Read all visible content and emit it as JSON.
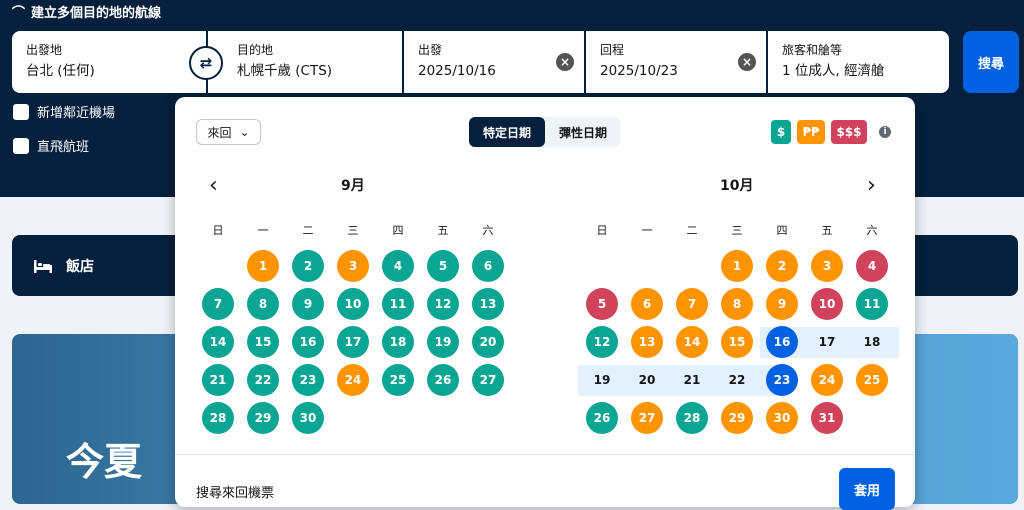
{
  "multi_city": "建立多個目的地的航線",
  "origin": {
    "label": "出發地",
    "value": "台北 (任何)"
  },
  "destination": {
    "label": "目的地",
    "value": "札幌千歲 (CTS)"
  },
  "depart": {
    "label": "出發",
    "value": "2025/10/16"
  },
  "return": {
    "label": "回程",
    "value": "2025/10/23"
  },
  "travellers": {
    "label": "旅客和艙等",
    "value": "1 位成人, 經濟艙"
  },
  "search_button": "搜尋",
  "checkboxes": {
    "nearby": "新增鄰近機場",
    "direct": "直飛航班"
  },
  "hotel_label": "飯店",
  "banner_text": "今夏",
  "calendar": {
    "trip_type": "來回",
    "tabs": [
      "特定日期",
      "彈性日期"
    ],
    "price_badges": [
      "$",
      "₱₱",
      "$$$"
    ],
    "weekdays": [
      "日",
      "一",
      "二",
      "三",
      "四",
      "五",
      "六"
    ],
    "colors": {
      "cheap": "#0ba593",
      "mid": "#ff9400",
      "high": "#d1435b",
      "selected": "#0062e3",
      "range": "#e3f0ff"
    },
    "months": [
      {
        "title": "9月",
        "days": [
          {
            "d": "1",
            "c": "mid"
          },
          {
            "d": "2",
            "c": "cheap"
          },
          {
            "d": "3",
            "c": "mid"
          },
          {
            "d": "4",
            "c": "cheap"
          },
          {
            "d": "5",
            "c": "cheap"
          },
          {
            "d": "6",
            "c": "cheap"
          },
          {
            "d": "7",
            "c": "cheap"
          },
          {
            "d": "8",
            "c": "cheap"
          },
          {
            "d": "9",
            "c": "cheap"
          },
          {
            "d": "10",
            "c": "cheap"
          },
          {
            "d": "11",
            "c": "cheap"
          },
          {
            "d": "12",
            "c": "cheap"
          },
          {
            "d": "13",
            "c": "cheap"
          },
          {
            "d": "14",
            "c": "cheap"
          },
          {
            "d": "15",
            "c": "cheap"
          },
          {
            "d": "16",
            "c": "cheap"
          },
          {
            "d": "17",
            "c": "cheap"
          },
          {
            "d": "18",
            "c": "cheap"
          },
          {
            "d": "19",
            "c": "cheap"
          },
          {
            "d": "20",
            "c": "cheap"
          },
          {
            "d": "21",
            "c": "cheap"
          },
          {
            "d": "22",
            "c": "cheap"
          },
          {
            "d": "23",
            "c": "cheap"
          },
          {
            "d": "24",
            "c": "mid"
          },
          {
            "d": "25",
            "c": "cheap"
          },
          {
            "d": "26",
            "c": "cheap"
          },
          {
            "d": "27",
            "c": "cheap"
          },
          {
            "d": "28",
            "c": "cheap"
          },
          {
            "d": "29",
            "c": "cheap"
          },
          {
            "d": "30",
            "c": "cheap"
          }
        ]
      },
      {
        "title": "10月",
        "days": [
          {
            "d": "1",
            "c": "mid"
          },
          {
            "d": "2",
            "c": "mid"
          },
          {
            "d": "3",
            "c": "mid"
          },
          {
            "d": "4",
            "c": "high"
          },
          {
            "d": "5",
            "c": "high"
          },
          {
            "d": "6",
            "c": "mid"
          },
          {
            "d": "7",
            "c": "mid"
          },
          {
            "d": "8",
            "c": "mid"
          },
          {
            "d": "9",
            "c": "mid"
          },
          {
            "d": "10",
            "c": "high"
          },
          {
            "d": "11",
            "c": "cheap"
          },
          {
            "d": "12",
            "c": "cheap"
          },
          {
            "d": "13",
            "c": "mid"
          },
          {
            "d": "14",
            "c": "mid"
          },
          {
            "d": "15",
            "c": "mid"
          },
          {
            "d": "16",
            "c": "selected"
          },
          {
            "d": "17",
            "c": "range"
          },
          {
            "d": "18",
            "c": "range"
          },
          {
            "d": "19",
            "c": "range"
          },
          {
            "d": "20",
            "c": "range"
          },
          {
            "d": "21",
            "c": "range"
          },
          {
            "d": "22",
            "c": "range"
          },
          {
            "d": "23",
            "c": "selected"
          },
          {
            "d": "24",
            "c": "mid"
          },
          {
            "d": "25",
            "c": "mid"
          },
          {
            "d": "26",
            "c": "cheap"
          },
          {
            "d": "27",
            "c": "mid"
          },
          {
            "d": "28",
            "c": "cheap"
          },
          {
            "d": "29",
            "c": "mid"
          },
          {
            "d": "30",
            "c": "mid"
          },
          {
            "d": "31",
            "c": "high"
          }
        ]
      }
    ],
    "footer_text": "搜尋來回機票",
    "apply_button": "套用"
  }
}
